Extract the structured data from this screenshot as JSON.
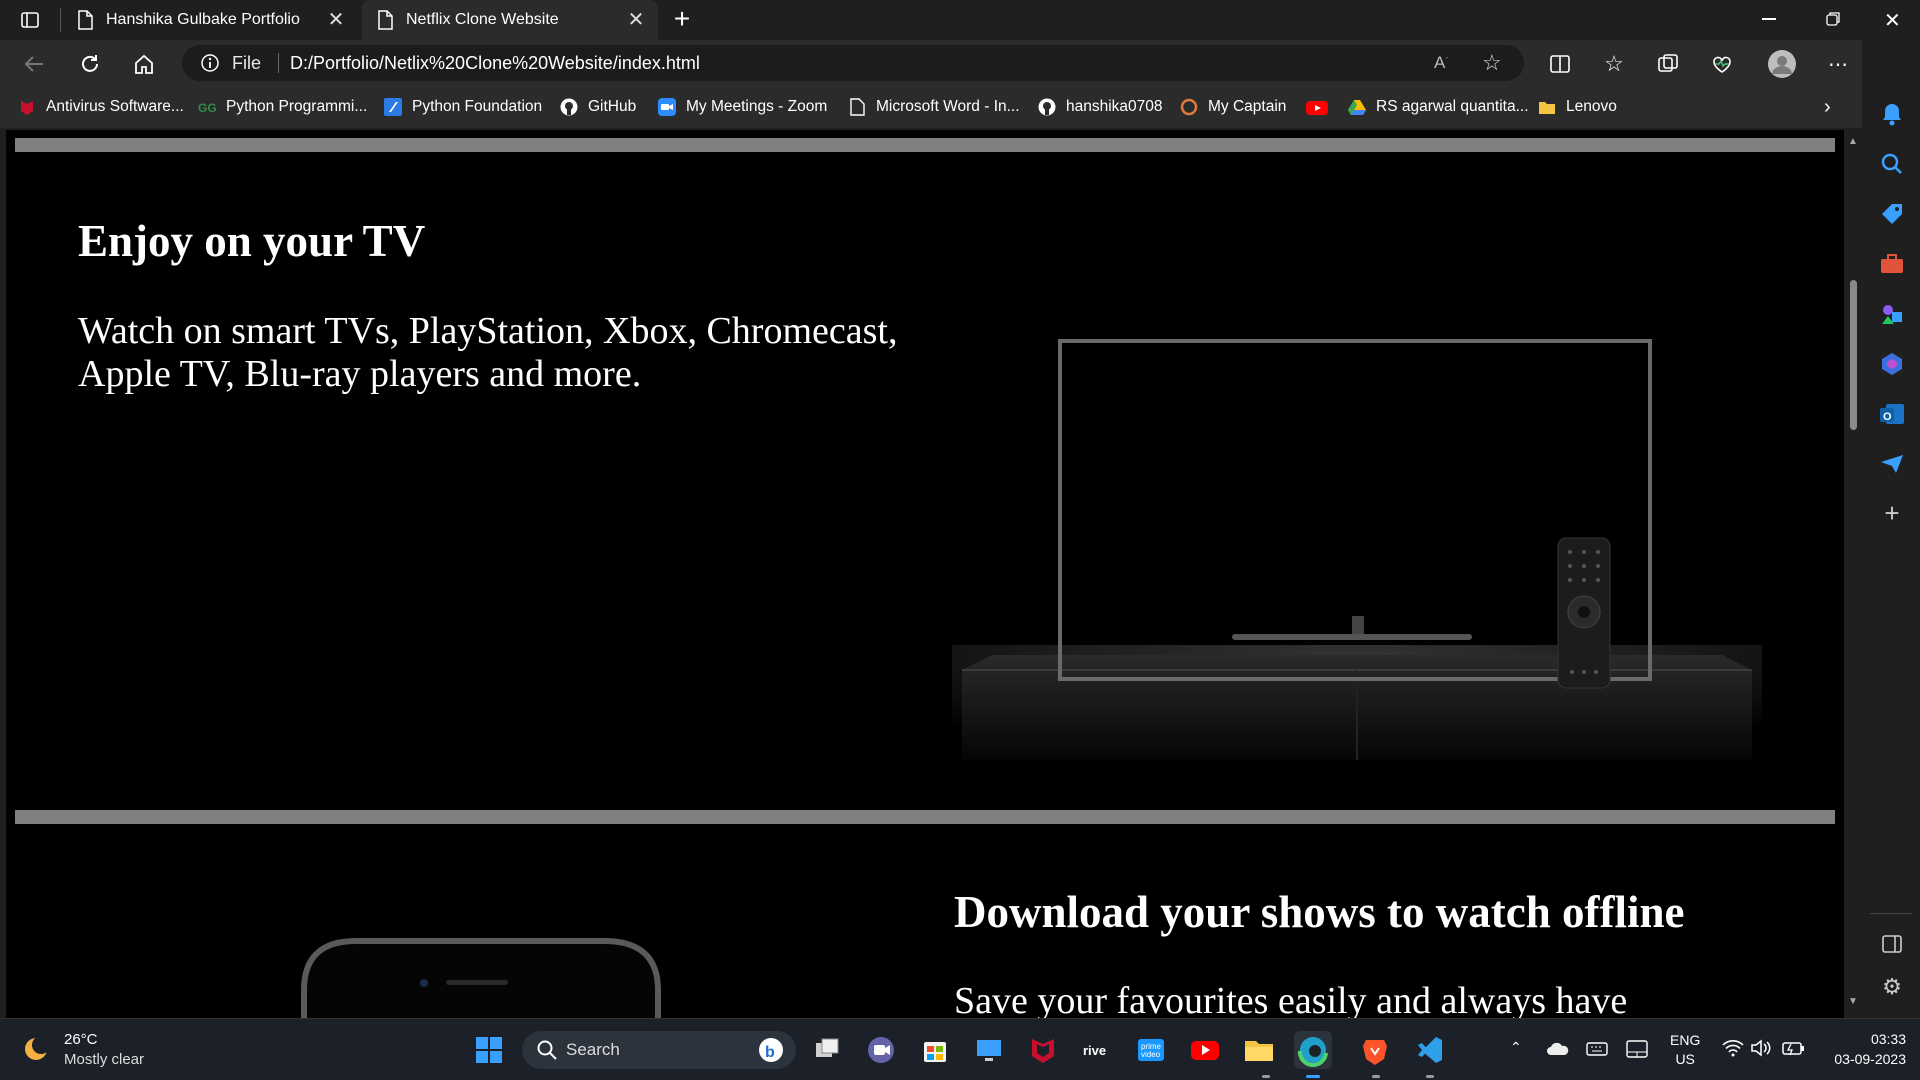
{
  "browser": {
    "tabs": [
      {
        "title": "Hanshika Gulbake Portfolio"
      },
      {
        "title": "Netflix Clone Website"
      }
    ],
    "address": {
      "scheme_label": "File",
      "url": "D:/Portfolio/Netlix%20Clone%20Website/index.html"
    },
    "bookmarks": [
      {
        "label": "Antivirus Software...",
        "icon": "mcafee-icon"
      },
      {
        "label": "Python Programmi...",
        "icon": "geeks-icon"
      },
      {
        "label": "Python Foundation",
        "icon": "python-foundation-icon"
      },
      {
        "label": "GitHub",
        "icon": "github-icon"
      },
      {
        "label": "My Meetings - Zoom",
        "icon": "zoom-icon"
      },
      {
        "label": "Microsoft Word - In...",
        "icon": "document-icon"
      },
      {
        "label": "hanshika0708",
        "icon": "github-icon"
      },
      {
        "label": "My Captain",
        "icon": "mycaptain-icon"
      },
      {
        "label": "",
        "icon": "youtube-icon"
      },
      {
        "label": "RS agarwal quantita...",
        "icon": "drive-icon"
      },
      {
        "label": "Lenovo",
        "icon": "folder-icon"
      }
    ]
  },
  "page": {
    "section1": {
      "heading": "Enjoy on your TV",
      "text_line1": "Watch on smart TVs, PlayStation, Xbox, Chromecast,",
      "text_line2": "Apple TV, Blu-ray players and more."
    },
    "section2": {
      "heading": "Download your shows to watch offline",
      "text": "Save your favourites easily and always have"
    }
  },
  "taskbar": {
    "weather": {
      "temp": "26°C",
      "condition": "Mostly clear"
    },
    "search_placeholder": "Search",
    "lang": {
      "line1": "ENG",
      "line2": "US"
    },
    "clock": {
      "time": "03:33",
      "date": "03-09-2023"
    }
  },
  "colors": {
    "page_bg": "#000000",
    "divider": "#808080",
    "accent": "#0078d4"
  }
}
